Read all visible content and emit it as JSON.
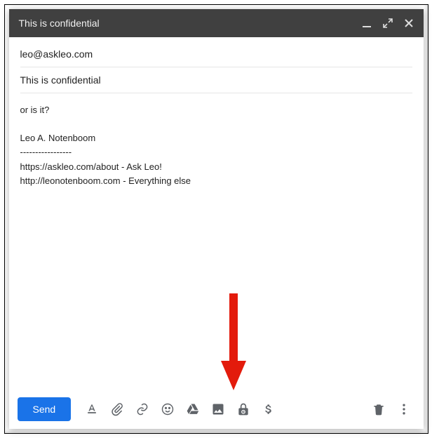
{
  "header": {
    "title": "This is confidential"
  },
  "fields": {
    "to": "leo@askleo.com",
    "subject": "This is confidential"
  },
  "body": {
    "lines": [
      "or is it?",
      "",
      "Leo A. Notenboom",
      "-----------------",
      "https://askleo.com/about - Ask Leo!",
      "http://leonotenboom.com - Everything else"
    ]
  },
  "toolbar": {
    "send_label": "Send"
  },
  "colors": {
    "accent": "#1a73e8",
    "arrow": "#e31b0c"
  }
}
